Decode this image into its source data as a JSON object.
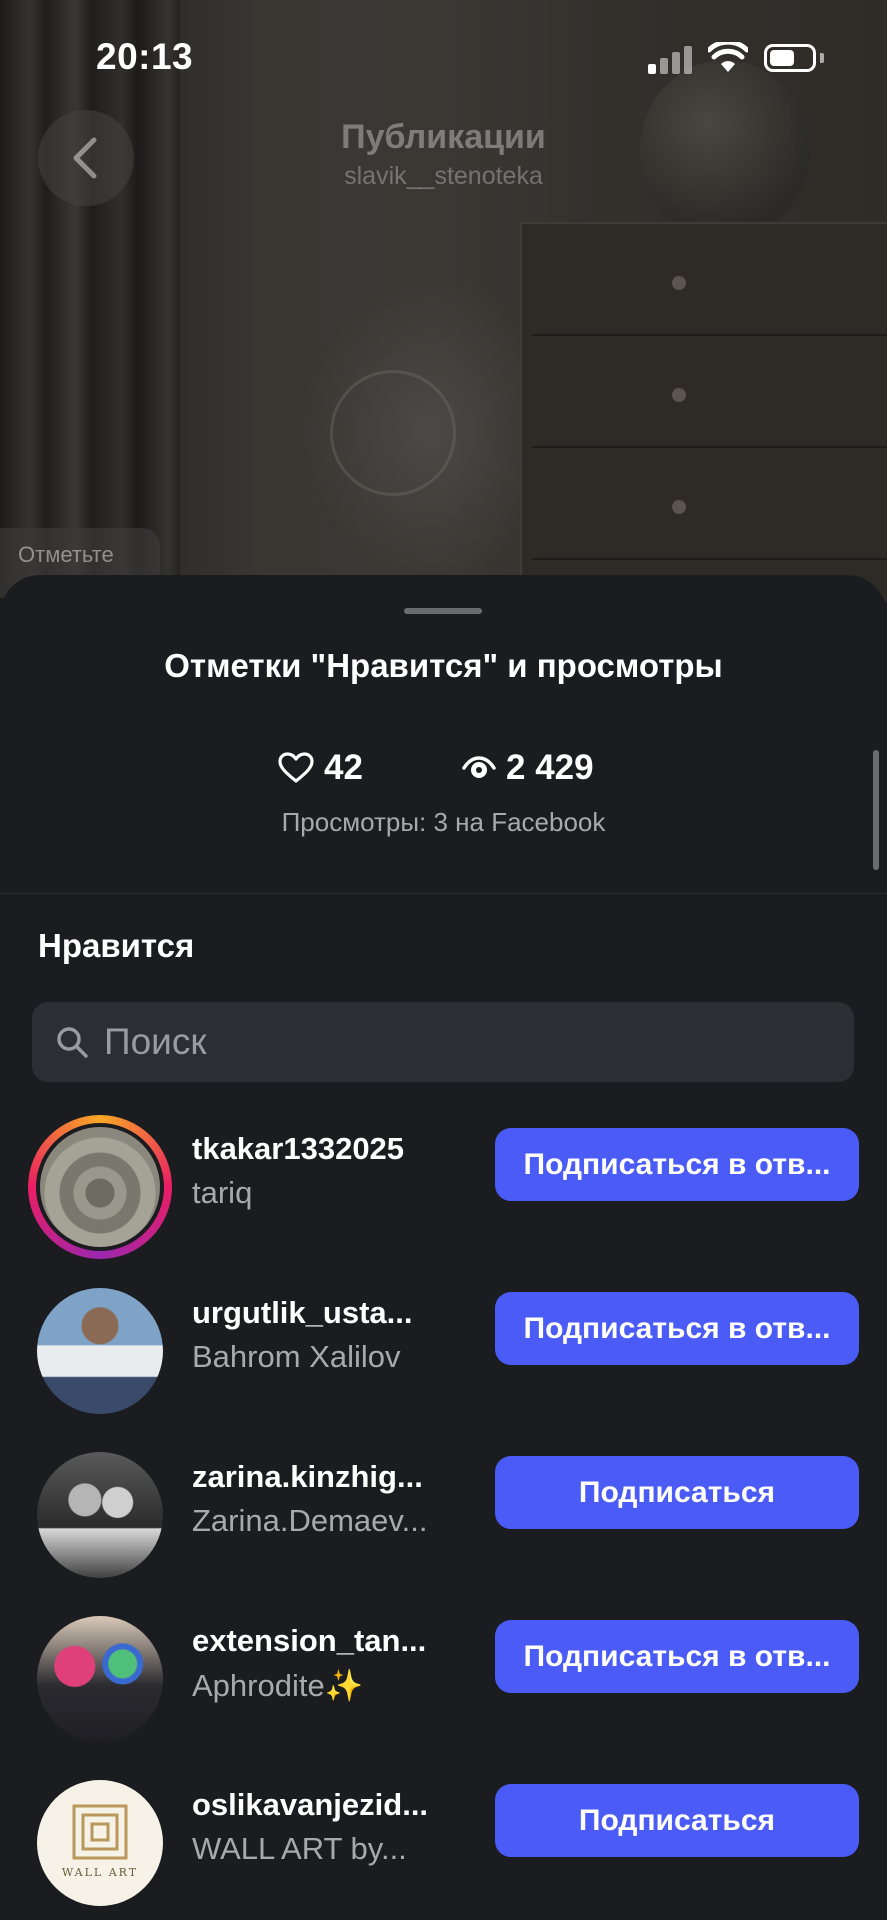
{
  "status_bar": {
    "time": "20:13"
  },
  "header": {
    "title": "Публикации",
    "subtitle": "slavik__stenoteka"
  },
  "tag_hint": "Отметьте",
  "sheet": {
    "title": "Отметки \"Нравится\" и просмотры",
    "likes_count": "42",
    "views_count": "2 429",
    "views_note": "Просмотры: 3 на Facebook",
    "section_title": "Нравится",
    "search_placeholder": "Поиск"
  },
  "users": [
    {
      "username": "tkakar1332025",
      "fullname": "tariq",
      "button": "Подписаться в отв...",
      "has_story": true
    },
    {
      "username": "urgutlik_usta...",
      "fullname": "Bahrom Xalilov",
      "button": "Подписаться в отв...",
      "has_story": false
    },
    {
      "username": "zarina.kinzhig...",
      "fullname": "Zarina.Demaev...",
      "button": "Подписаться",
      "has_story": false
    },
    {
      "username": "extension_tan...",
      "fullname": "Aphrodite✨",
      "button": "Подписаться в отв...",
      "has_story": false
    },
    {
      "username": "oslikavanjezid...",
      "fullname": "WALL ART by...",
      "button": "Подписаться",
      "has_story": false
    }
  ],
  "colors": {
    "accent": "#4a5cf5",
    "background": "#1b1c1f",
    "search_bg": "#2c2e33"
  }
}
